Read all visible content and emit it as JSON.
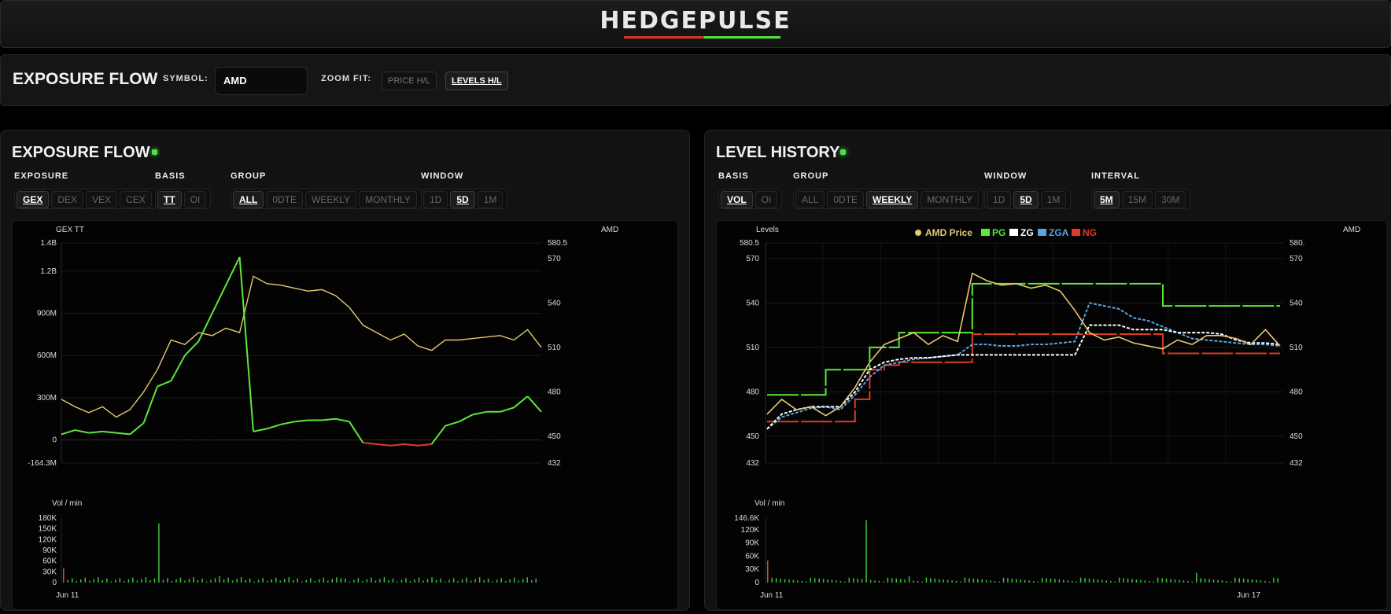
{
  "header": {
    "logo": "HEDGEPULSE"
  },
  "toolbar": {
    "title": "EXPOSURE FLOW",
    "symbol_label": "SYMBOL:",
    "symbol_value": "AMD",
    "zoom_label": "ZOOM FIT:",
    "zoom_options": [
      "PRICE H/L",
      "LEVELS H/L"
    ],
    "zoom_active": "LEVELS H/L"
  },
  "exposure_panel": {
    "title": "EXPOSURE FLOW",
    "groups": [
      {
        "label": "EXPOSURE",
        "options": [
          "GEX",
          "DEX",
          "VEX",
          "CEX"
        ],
        "active": "GEX"
      },
      {
        "label": "BASIS",
        "options": [
          "TT",
          "OI"
        ],
        "active": "TT"
      },
      {
        "label": "GROUP",
        "options": [
          "ALL",
          "0DTE",
          "WEEKLY",
          "MONTHLY"
        ],
        "active": "ALL"
      },
      {
        "label": "WINDOW",
        "options": [
          "1D",
          "5D",
          "1M"
        ],
        "active": "5D"
      }
    ],
    "chart": {
      "left_axis_title": "GEX TT",
      "right_axis_title": "AMD",
      "left_ticks": [
        "1.4B",
        "1.2B",
        "900M",
        "600M",
        "300M",
        "0",
        "-164.3M"
      ],
      "right_ticks": [
        "580.5",
        "570",
        "540",
        "510",
        "480",
        "450",
        "432"
      ],
      "volume_title": "Vol / min",
      "volume_ticks": [
        "180K",
        "150K",
        "120K",
        "90K",
        "60K",
        "30K",
        "0"
      ],
      "x_label": "Jun 11"
    }
  },
  "level_panel": {
    "title": "LEVEL HISTORY",
    "groups": [
      {
        "label": "BASIS",
        "options": [
          "VOL",
          "OI"
        ],
        "active": "VOL"
      },
      {
        "label": "GROUP",
        "options": [
          "ALL",
          "0DTE",
          "WEEKLY",
          "MONTHLY"
        ],
        "active": "WEEKLY"
      },
      {
        "label": "WINDOW",
        "options": [
          "1D",
          "5D",
          "1M"
        ],
        "active": "5D"
      },
      {
        "label": "INTERVAL",
        "options": [
          "5M",
          "15M",
          "30M"
        ],
        "active": "5M"
      }
    ],
    "chart": {
      "left_axis_title": "Levels",
      "right_axis_title": "AMD",
      "legend": [
        "AMD Price",
        "PG",
        "ZG",
        "ZGA",
        "NG"
      ],
      "left_ticks": [
        "580.5",
        "570",
        "540",
        "510",
        "480",
        "450",
        "432"
      ],
      "right_ticks": [
        "580.",
        "570",
        "540",
        "510",
        "480",
        "450",
        "432"
      ],
      "volume_title": "Vol / min",
      "volume_ticks": [
        "146.6K",
        "120K",
        "90K",
        "60K",
        "30K",
        "0"
      ],
      "x_labels": [
        "Jun 11",
        "Jun 17"
      ]
    }
  },
  "colors": {
    "price": "#e7c873",
    "pg": "#5ee83a",
    "zg": "#ffffff",
    "zga": "#5aa3e6",
    "ng": "#e03a26",
    "gex_neg": "#e03a26"
  },
  "chart_data": [
    {
      "type": "line",
      "title": "",
      "ylabel": "GEX TT",
      "y2label": "AMD",
      "ylim": [
        -164300000,
        1400000000
      ],
      "y2lim": [
        432,
        580.5
      ],
      "series": [
        {
          "name": "GEX TT",
          "values": [
            40000000,
            70000000,
            50000000,
            60000000,
            50000000,
            40000000,
            120000000,
            380000000,
            420000000,
            600000000,
            700000000,
            900000000,
            1100000000,
            1300000000,
            60000000,
            80000000,
            110000000,
            130000000,
            140000000,
            140000000,
            150000000,
            130000000,
            -20000000,
            -30000000,
            -40000000,
            -30000000,
            -40000000,
            -30000000,
            100000000,
            130000000,
            180000000,
            200000000,
            200000000,
            230000000,
            310000000,
            200000000
          ]
        },
        {
          "name": "AMD",
          "values": [
            475,
            470,
            466,
            470,
            463,
            468,
            480,
            495,
            515,
            512,
            520,
            518,
            523,
            520,
            558,
            553,
            552,
            550,
            548,
            549,
            545,
            537,
            525,
            520,
            515,
            519,
            511,
            508,
            515,
            515,
            516,
            517,
            518,
            515,
            522,
            510
          ]
        }
      ]
    },
    {
      "type": "line",
      "title": "",
      "ylabel": "Levels",
      "ylim": [
        432,
        580.5
      ],
      "series": [
        {
          "name": "AMD Price",
          "values": [
            465,
            475,
            468,
            470,
            464,
            470,
            483,
            500,
            512,
            516,
            520,
            512,
            518,
            514,
            560,
            555,
            552,
            553,
            550,
            552,
            548,
            535,
            520,
            515,
            517,
            513,
            511,
            509,
            515,
            512,
            518,
            518,
            516,
            512,
            522,
            511
          ]
        },
        {
          "name": "PG",
          "values": [
            478,
            478,
            478,
            478,
            495,
            495,
            495,
            510,
            510,
            520,
            520,
            520,
            520,
            520,
            553,
            553,
            553,
            553,
            553,
            553,
            553,
            553,
            553,
            553,
            553,
            553,
            553,
            538,
            538,
            538,
            538,
            538,
            538,
            538,
            538,
            538
          ]
        },
        {
          "name": "ZG",
          "values": [
            455,
            465,
            468,
            470,
            470,
            470,
            480,
            495,
            500,
            502,
            503,
            503,
            504,
            505,
            505,
            505,
            505,
            505,
            505,
            505,
            505,
            505,
            525,
            525,
            525,
            522,
            522,
            522,
            520,
            520,
            520,
            519,
            515,
            513,
            513,
            512
          ]
        },
        {
          "name": "ZGA",
          "values": [
            455,
            463,
            466,
            469,
            470,
            468,
            478,
            490,
            498,
            500,
            502,
            503,
            504,
            505,
            512,
            512,
            511,
            511,
            512,
            512,
            513,
            514,
            540,
            538,
            536,
            530,
            528,
            524,
            520,
            516,
            515,
            514,
            513,
            512,
            512,
            511
          ]
        },
        {
          "name": "NG",
          "values": [
            460,
            460,
            460,
            460,
            460,
            460,
            475,
            495,
            498,
            500,
            500,
            500,
            500,
            500,
            519,
            519,
            519,
            519,
            519,
            519,
            519,
            519,
            519,
            519,
            519,
            519,
            519,
            506,
            506,
            506,
            506,
            506,
            506,
            506,
            506,
            506
          ]
        }
      ]
    }
  ]
}
